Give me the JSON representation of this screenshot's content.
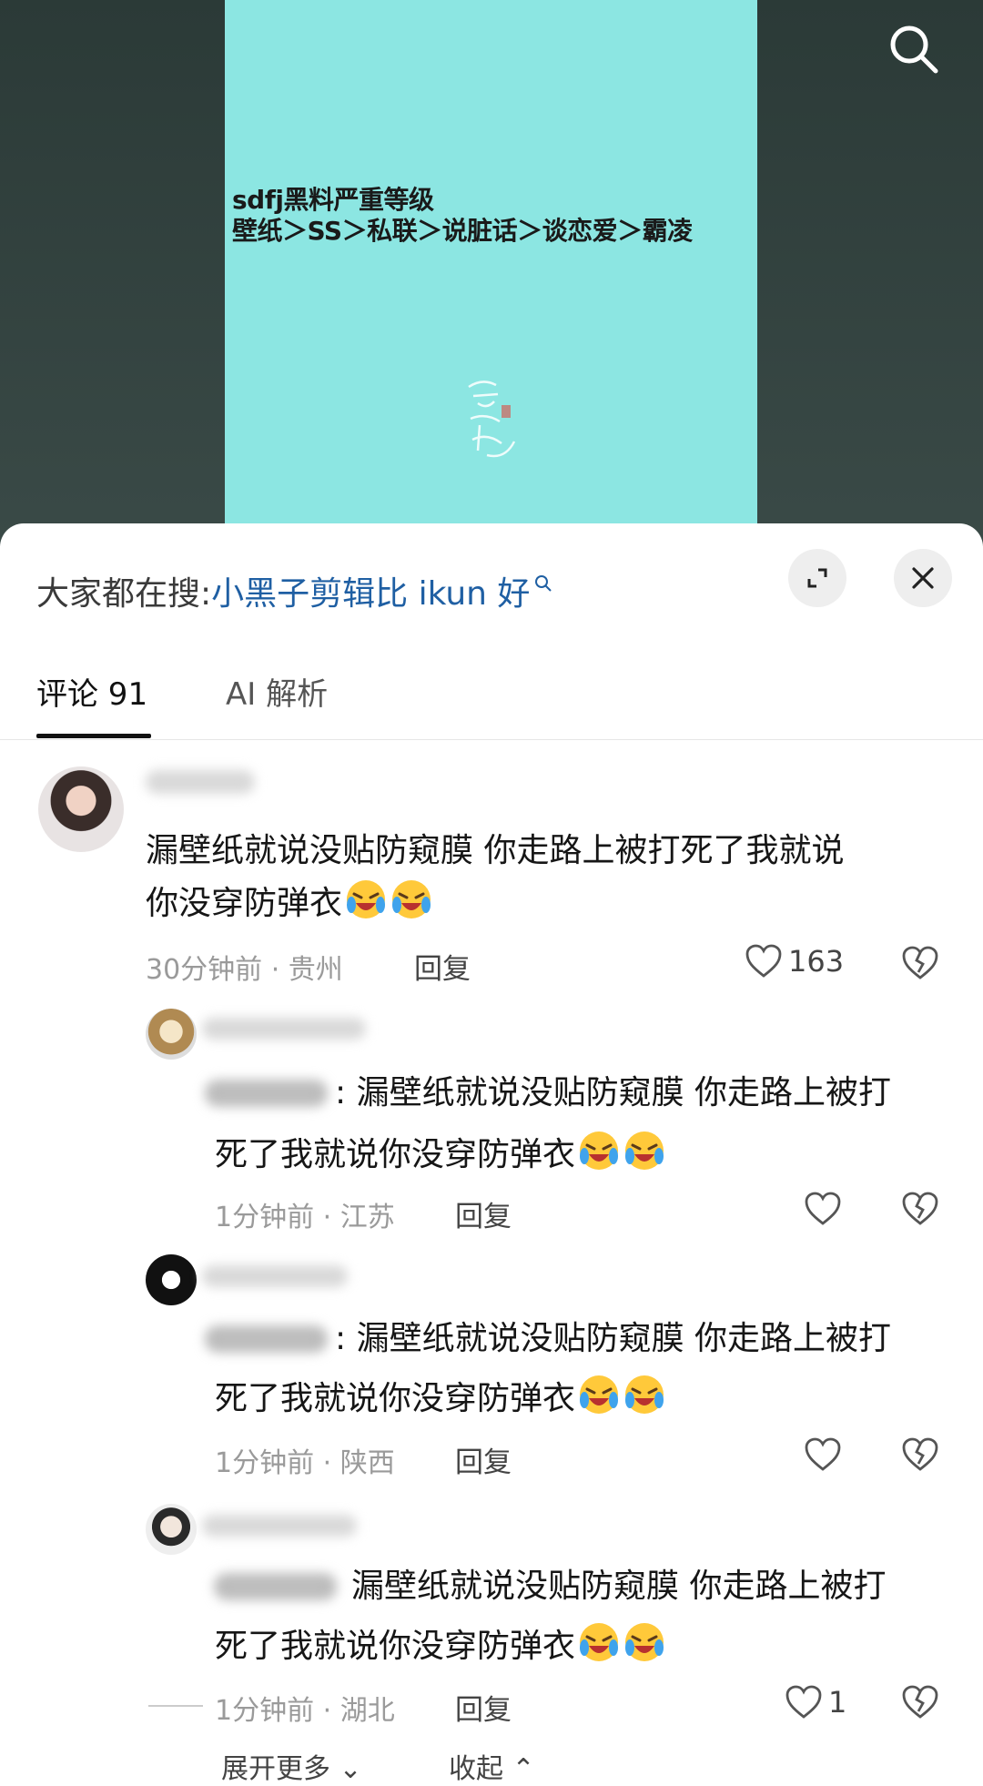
{
  "video": {
    "line1": "sdfj黑料严重等级",
    "line2": "壁纸＞SS＞私联＞说脏话＞谈恋爱＞霸凌"
  },
  "hot_search": {
    "prefix": "大家都在搜:",
    "query": "小黑子剪辑比 ikun 好"
  },
  "tabs": [
    {
      "label": "评论 91",
      "active": true
    },
    {
      "label": "AI 解析",
      "active": false
    }
  ],
  "comments": [
    {
      "line1": "漏壁纸就说没贴防窥膜 你走路上被打死了我就说",
      "line2": "你没穿防弹衣",
      "meta": "30分钟前 · 贵州",
      "reply": "回复",
      "likes": "163"
    }
  ],
  "replies": [
    {
      "line1": ": 漏壁纸就说没贴防窥膜 你走路上被打",
      "line2": "死了我就说你没穿防弹衣",
      "meta": "1分钟前 · 江苏",
      "reply": "回复",
      "likes": ""
    },
    {
      "line1": ": 漏壁纸就说没贴防窥膜 你走路上被打",
      "line2": "死了我就说你没穿防弹衣",
      "meta": "1分钟前 · 陕西",
      "reply": "回复",
      "likes": ""
    },
    {
      "line1": "漏壁纸就说没贴防窥膜 你走路上被打",
      "line2": "死了我就说你没穿防弹衣",
      "meta": "1分钟前 · 湖北",
      "reply": "回复",
      "likes": "1"
    }
  ],
  "footer": {
    "expand": "展开更多",
    "collapse": "收起"
  },
  "icons": {
    "search": "search-icon",
    "collapse": "collapse-icon",
    "close": "close-icon",
    "heart": "heart-icon",
    "broken_heart": "broken-heart-icon",
    "emoji": "crying-laughing-emoji"
  },
  "colors": {
    "video_bg": "#8ce6e2",
    "link": "#1f5fa3",
    "meta": "#9a9a9a"
  }
}
